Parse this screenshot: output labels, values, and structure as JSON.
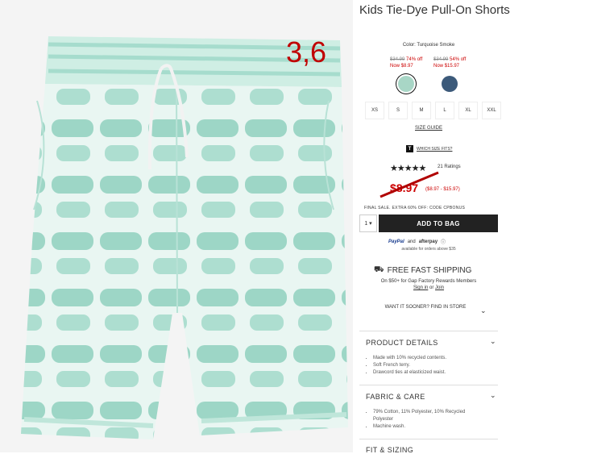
{
  "annotation": "3,6",
  "product": {
    "title": "Kids Tie-Dye Pull-On Shorts",
    "color_label": "Color: Turquoise Smoke",
    "options": [
      {
        "old_price": "$34.99",
        "discount": "74% off",
        "now": "Now $8.97"
      },
      {
        "old_price": "$34.99",
        "discount": "54% off",
        "now": "Now $15.97"
      }
    ],
    "swatch_colors": [
      "#a8d6c6",
      "#3c5a7a"
    ],
    "sizes": [
      "XS",
      "S",
      "M",
      "L",
      "XL",
      "XXL"
    ],
    "size_guide": "SIZE GUIDE",
    "which_size": "WHICH SIZE FITS?",
    "which_size_icon": "T",
    "stars": "★★★★★",
    "ratings": "21 Ratings",
    "price": "$8.97",
    "price_range": "($8.97 - $15.97)",
    "promo": "FINAL SALE. EXTRA 60% OFF: CODE CPBONUS",
    "qty": "1",
    "add_to_bag": "ADD TO BAG",
    "paypal": "PayPal",
    "and": "and",
    "afterpay": "afterpay",
    "available": "available for orders above $35",
    "shipping": "FREE FAST SHIPPING",
    "shipping_sub": "On $50+ for Gap Factory Rewards Members",
    "sign_in": "Sign in",
    "or": "or",
    "join": "Join",
    "sooner": "WANT IT SOONER? FIND IN STORE",
    "details_title": "PRODUCT DETAILS",
    "details": [
      "Made with 10% recycled contents.",
      "Soft French terry.",
      "Drawcord ties at elasticized waist."
    ],
    "care_title": "FABRIC & CARE",
    "care": [
      "79% Cotton, 11% Polyester, 10% Recycled Polyester",
      "Machine wash."
    ],
    "fit_title": "FIT & SIZING"
  }
}
